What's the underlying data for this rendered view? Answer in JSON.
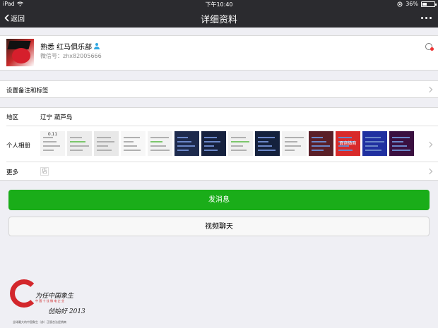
{
  "status_bar": {
    "device": "iPad",
    "time": "下午10:40",
    "battery": "36%",
    "battery_level": 0.36
  },
  "nav": {
    "back_label": "返回",
    "title": "详细资料"
  },
  "profile": {
    "name": "熟悉 红马俱乐部",
    "wechat_id": "微信号：zhx82005666"
  },
  "remark": {
    "label": "设置备注和标签"
  },
  "details": {
    "region_label": "地区",
    "region_value": "辽宁 葫芦岛",
    "album_label": "个人相册",
    "more_label": "更多",
    "more_shop": "店",
    "album_count": 14,
    "album_text_5": "0.11",
    "album_text_12": "面商微商"
  },
  "actions": {
    "send_message": "发消息",
    "video_call": "视频聊天"
  },
  "watermark": {
    "title": "为任中国象生",
    "subtitle": "中 国 十 佳 微 电 企 业",
    "signature": "创始好 2013",
    "caption": "全球最大的中国象生（苏）正版合法经销商"
  },
  "colors": {
    "nav_bg": "#2b2b2f",
    "send_button": "#1aad19",
    "page_bg": "#efeff4",
    "accent_red": "#d3272c"
  }
}
